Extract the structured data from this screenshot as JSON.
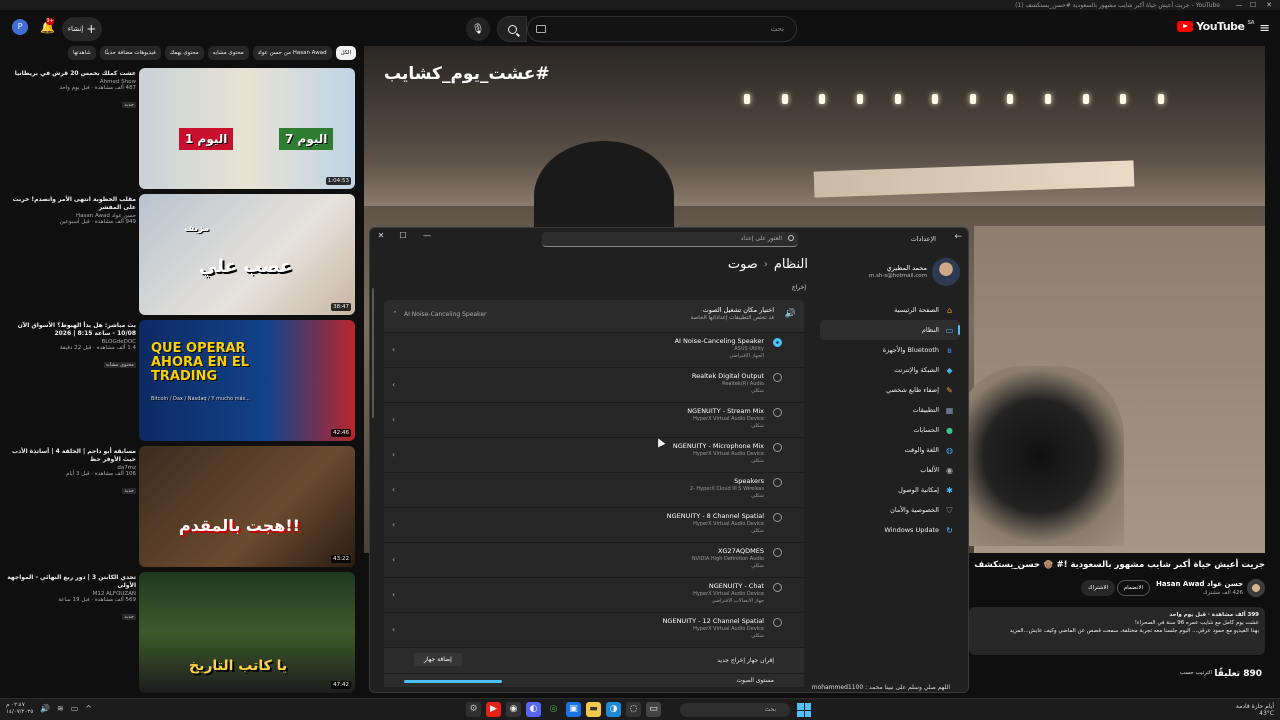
{
  "browser": {
    "tab_title": "YouTube - جريت أعيش حياة أكبر شايب مشهور بالسعودية #حسن_يستكشف (1)",
    "controls": [
      "—",
      "☐",
      "✕"
    ]
  },
  "header": {
    "logo": "YouTube",
    "logo_region": "SA",
    "search_placeholder": "بحث",
    "create_label": "إنشاء",
    "notification_count": "9+",
    "avatar_letter": "P"
  },
  "chips": [
    "الكل",
    "من حسن عواد Hasan Awad",
    "محتوى مشابه",
    "محتوى يهمك",
    "فيديوهات مضافة حديثًا",
    "شاهدتها"
  ],
  "recommendations": [
    {
      "title": "عشت كملك بخمس 20 قرش في بريطانيا",
      "channel": "Ahmed Show",
      "views": "487 ألف مشاهدة · قبل يوم واحد",
      "badge": "جديد",
      "duration": "1:04:53",
      "overlay_a": "اليوم 1",
      "overlay_b": "اليوم 7"
    },
    {
      "title": "مقلب الخطوبة انتهى الأمر وانصدم! خربت على المفشر",
      "channel": "حسن عواد Hasan Awad",
      "views": "949 ألف مشاهدة · قبل أسبوعين",
      "badge": "",
      "duration": "38:47",
      "overlay_a": "عصب علي",
      "overlay_b": "مزيف"
    },
    {
      "title": "بث مباشر: هل بدأ الهبوط؟ الأسواق الآن 10/08 - ساعة 8:15 | 2026",
      "channel": "BLOGdeDOC",
      "views": "1.4 ألف مشاهدة · قبل 22 دقيقة",
      "badge": "محتوى مشابه",
      "duration": "42:46",
      "overlay_a": "QUE OPERAR AHORA EN EL TRADING",
      "overlay_b": "Bitcoin / Dax / Nasdaq / Y mucho más..."
    },
    {
      "title": "مسابقة أبو داحم | الحلقة 4 | أساتذة الأدب حيث الأوفر حظ",
      "channel": "da7mz",
      "views": "106 ألف مشاهدة · قبل 3 أيام",
      "badge": "جديد",
      "duration": "43:22",
      "overlay_a": "هجت بالمقدم!!",
      "overlay_b": ""
    },
    {
      "title": "تحدي الكابتن 3 | دور ربع النهائي - المواجهة الأولى",
      "channel": "M12 ALFOUZAN",
      "views": "569 ألف مشاهدة · قبل 19 ساعة",
      "badge": "جديد",
      "duration": "47:42",
      "overlay_a": "يا كاتب التاريخ",
      "overlay_b": ""
    }
  ],
  "player": {
    "hashtag": "#عشت_يوم_كشايب"
  },
  "settings": {
    "window_title": "الإعدادات",
    "search_placeholder": "العثور على إعداد",
    "user_name": "محمد المطيري",
    "user_email": "m.sh-s@hotmail.com",
    "breadcrumb_parent": "النظام",
    "breadcrumb_current": "صوت",
    "section_output": "إخراج",
    "nav": [
      {
        "label": "الصفحة الرئيسية",
        "icon": "home-icon",
        "glyph": "⌂",
        "color": "#f0a030",
        "active": false
      },
      {
        "label": "النظام",
        "icon": "system-icon",
        "glyph": "▭",
        "color": "#4cc2ff",
        "active": true
      },
      {
        "label": "Bluetooth والأجهزة",
        "icon": "bluetooth-icon",
        "glyph": "ʙ",
        "color": "#4a8ef0",
        "active": false
      },
      {
        "label": "الشبكة والإنترنت",
        "icon": "network-icon",
        "glyph": "◆",
        "color": "#48b0e8",
        "active": false
      },
      {
        "label": "إضفاء طابع شخصي",
        "icon": "brush-icon",
        "glyph": "✎",
        "color": "#e8a040",
        "active": false
      },
      {
        "label": "التطبيقات",
        "icon": "apps-icon",
        "glyph": "▦",
        "color": "#8a9ab8",
        "active": false
      },
      {
        "label": "الحسابات",
        "icon": "accounts-icon",
        "glyph": "●",
        "color": "#3cc08a",
        "active": false
      },
      {
        "label": "اللغة والوقت",
        "icon": "globe-icon",
        "glyph": "◍",
        "color": "#4aa0e8",
        "active": false
      },
      {
        "label": "الألعاب",
        "icon": "gamepad-icon",
        "glyph": "◉",
        "color": "#aaaaaa",
        "active": false
      },
      {
        "label": "إمكانية الوصول",
        "icon": "accessibility-icon",
        "glyph": "✱",
        "color": "#4cc2ff",
        "active": false
      },
      {
        "label": "الخصوصية والأمان",
        "icon": "shield-icon",
        "glyph": "⛉",
        "color": "#8a8a8a",
        "active": false
      },
      {
        "label": "Windows Update",
        "icon": "update-icon",
        "glyph": "↻",
        "color": "#4cc2ff",
        "active": false
      }
    ],
    "output_choose_title": "اختيار مكان تشغيل الصوت",
    "output_choose_sub": "قد تختص التطبيقات إعداداتها الخاصة",
    "current_device": "AI Noise-Canceling Speaker",
    "devices": [
      {
        "name": "AI Noise-Canceling Speaker",
        "desc": "ASUS Utility",
        "desc2": "الجهاز الافتراضي",
        "selected": true
      },
      {
        "name": "Realtek Digital Output",
        "desc": "Realtek(R) Audio",
        "desc2": "شكلي",
        "selected": false
      },
      {
        "name": "NGENUITY - Stream Mix",
        "desc": "HyperX Virtual Audio Device",
        "desc2": "شكلي",
        "selected": false
      },
      {
        "name": "NGENUITY - Microphone Mix",
        "desc": "HyperX Virtual Audio Device",
        "desc2": "شكلي",
        "selected": false
      },
      {
        "name": "Speakers",
        "desc": "2- HyperX Cloud III S Wireless",
        "desc2": "شكلي",
        "selected": false
      },
      {
        "name": "NGENUITY - 8 Channel Spatial",
        "desc": "HyperX Virtual Audio Device",
        "desc2": "شكلي",
        "selected": false
      },
      {
        "name": "XG27AQDMES",
        "desc": "NVIDIA High Definition Audio",
        "desc2": "شكلي",
        "selected": false
      },
      {
        "name": "NGENUITY - Chat",
        "desc": "HyperX Virtual Audio Device",
        "desc2": "جهاز الاتصالات الافتراضي",
        "selected": false
      },
      {
        "name": "NGENUITY - 12 Channel Spatial",
        "desc": "HyperX Virtual Audio Device",
        "desc2": "شكلي",
        "selected": false
      }
    ],
    "pair_label": "إقران جهاز إخراج جديد",
    "pair_button": "إضافة جهاز",
    "volume_label": "مستوى الصوت",
    "volume_level": 0.7
  },
  "video": {
    "title": "جريت أعيش حياة أكبر شايب مشهور بالسعودية !# 👴🏽 حسن_يستكشف",
    "channel": "حسن عواد Hasan Awad",
    "subscribers": "426 ألف مشترك",
    "join_label": "الانضمام",
    "subscribe_label": "الاشتراك",
    "views_line": "399 ألف مشاهدة · قبل يوم واحد",
    "desc_line1": "عشت يوم كامل مع شايب عمره 96 سنة في الصحراء!",
    "desc_line2": "بهذا الفيديو مع حمود عرقي... اليوم جلسنا معه تجربة مختلفة، سمعت قصص عن الماضي وكيف عايش...المزيد",
    "comments_count": "890 تعليقًا",
    "sort_label": "الترتيب حسب",
    "comment_peek": "اللهم صلي وسلم على نبينا محمد : mohammed1100"
  },
  "taskbar": {
    "search_placeholder": "بحث",
    "weather_line1": "أيام حارة قادمة",
    "weather_line2": "43°C",
    "time": "٠٢:٤٧ م",
    "date": "١٤/٠٧/٢٠٢٥"
  }
}
